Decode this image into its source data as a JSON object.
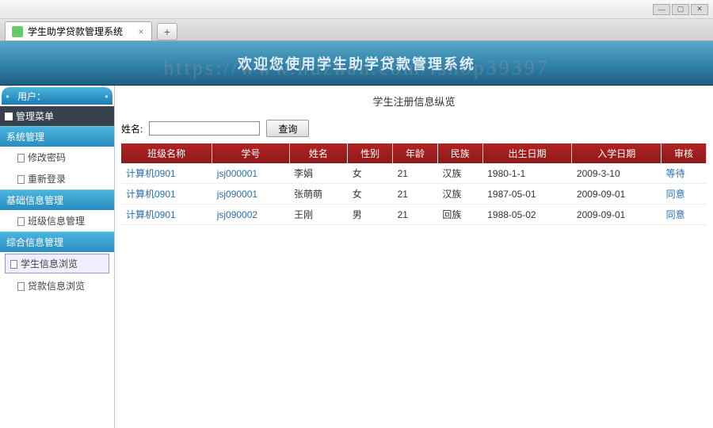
{
  "window": {
    "tab_title": "学生助学贷款管理系统",
    "min": "—",
    "max": "▢",
    "close": "✕",
    "newtab": "+",
    "tabclose": "×"
  },
  "banner": {
    "title": "欢迎您使用学生助学贷款管理系统"
  },
  "watermark": "https://www.huzhan.com/ishop39397",
  "sidebar": {
    "cap": "用户：",
    "menu_root": "管理菜单",
    "sec1": {
      "title": "系统管理",
      "items": [
        "修改密码",
        "重新登录"
      ]
    },
    "sec2": {
      "title": "基础信息管理",
      "items": [
        "班级信息管理"
      ]
    },
    "sec3": {
      "title": "综合信息管理",
      "items": [
        "学生信息浏览",
        "贷款信息浏览"
      ]
    }
  },
  "main": {
    "title": "学生注册信息纵览",
    "search_label": "姓名:",
    "search_btn": "查询",
    "columns": [
      "班级名称",
      "学号",
      "姓名",
      "性别",
      "年龄",
      "民族",
      "出生日期",
      "入学日期",
      "审核"
    ],
    "rows": [
      {
        "class": "计算机0901",
        "sid": "jsj000001",
        "name": "李娟",
        "sex": "女",
        "age": "21",
        "nation": "汉族",
        "dob": "1980-1-1",
        "enroll": "2009-3-10",
        "audit": "等待"
      },
      {
        "class": "计算机0901",
        "sid": "jsj090001",
        "name": "张萌萌",
        "sex": "女",
        "age": "21",
        "nation": "汉族",
        "dob": "1987-05-01",
        "enroll": "2009-09-01",
        "audit": "同意"
      },
      {
        "class": "计算机0901",
        "sid": "jsj090002",
        "name": "王刚",
        "sex": "男",
        "age": "21",
        "nation": "回族",
        "dob": "1988-05-02",
        "enroll": "2009-09-01",
        "audit": "同意"
      }
    ]
  }
}
